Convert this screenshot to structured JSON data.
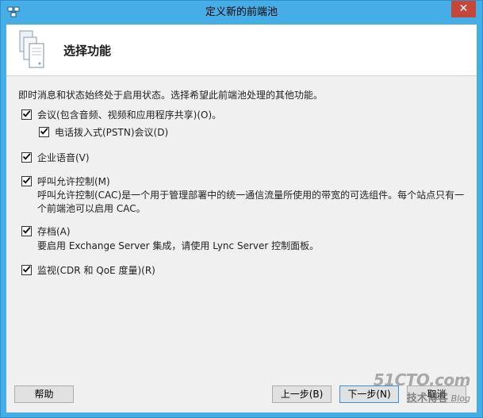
{
  "window": {
    "title": "定义新的前端池",
    "close_glyph": "✕"
  },
  "header": {
    "title": "选择功能"
  },
  "intro_text": "即时消息和状态始终处于启用状态。选择希望此前端池处理的其他功能。",
  "options": [
    {
      "label": "会议(包含音频、视频和应用程序共享)(O)。",
      "checked": true
    },
    {
      "label": "电话拨入式(PSTN)会议(D)",
      "checked": true
    },
    {
      "label": "企业语音(V)",
      "checked": true
    },
    {
      "label": "呼叫允许控制(M)",
      "checked": true,
      "description_lines": [
        "呼叫允许控制(CAC)是一个用于管理部署中的统一通信流量所使用的带宽的可选组件。每个站点只有一",
        "个前端池可以启用 CAC。"
      ]
    },
    {
      "label": "存档(A)",
      "checked": true,
      "description_lines": [
        "要启用 Exchange Server 集成，请使用 Lync Server 控制面板。"
      ]
    },
    {
      "label": "监视(CDR 和 QoE 度量)(R)",
      "checked": true
    }
  ],
  "buttons": {
    "help": "帮助",
    "back": "上一步(B)",
    "next": "下一步(N)",
    "cancel": "取消"
  },
  "watermark": {
    "main": "51CTO.com",
    "sub": "技术博客",
    "blog": "Blog"
  },
  "colors": {
    "titlebar": "#46aee6",
    "close": "#c7463a",
    "client": "#f0f0f0"
  }
}
